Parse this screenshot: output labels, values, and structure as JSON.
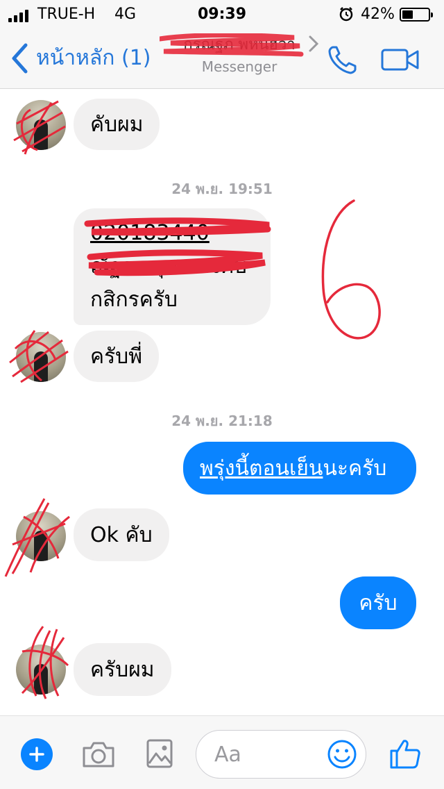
{
  "status_bar": {
    "carrier": "TRUE-H",
    "network": "4G",
    "time": "09:39",
    "battery_percent": "42%",
    "battery_level": 0.42
  },
  "nav": {
    "back_label": "หน้าหลัก (1)",
    "contact_name": "กรณฐภ พหนฮวา",
    "contact_subtitle": "Messenger",
    "accent_color": "#2577d9"
  },
  "messages": {
    "m1": {
      "text": "คับผม"
    },
    "ts1": {
      "text": "24 พ.ย. 19:51"
    },
    "m2": {
      "line1": "020183440",
      "line2": "ณัฐกร ธุเขตวงศ์ษ",
      "line3": "กสิกรครับ"
    },
    "m3": {
      "text": "ครับพี่"
    },
    "ts2": {
      "text": "24 พ.ย. 21:18"
    },
    "m4": {
      "link_part": "พรุ่งนี้ตอนเย็น",
      "rest": "นะครับ"
    },
    "m5": {
      "text": "Ok คับ"
    },
    "m6": {
      "text": "ครับ"
    },
    "m7": {
      "text": "ครับผม"
    }
  },
  "composer": {
    "placeholder": "Aa"
  },
  "colors": {
    "outgoing_bubble": "#0a84ff",
    "incoming_bubble": "#f1f0f0",
    "scribble": "#e5293b"
  },
  "icons": {
    "back": "chevron-left-icon",
    "chevron": "chevron-right-icon",
    "call": "phone-icon",
    "video": "video-camera-icon",
    "add": "plus-icon",
    "camera": "camera-icon",
    "image": "image-icon",
    "emoji": "smiley-icon",
    "like": "thumbs-up-icon"
  }
}
